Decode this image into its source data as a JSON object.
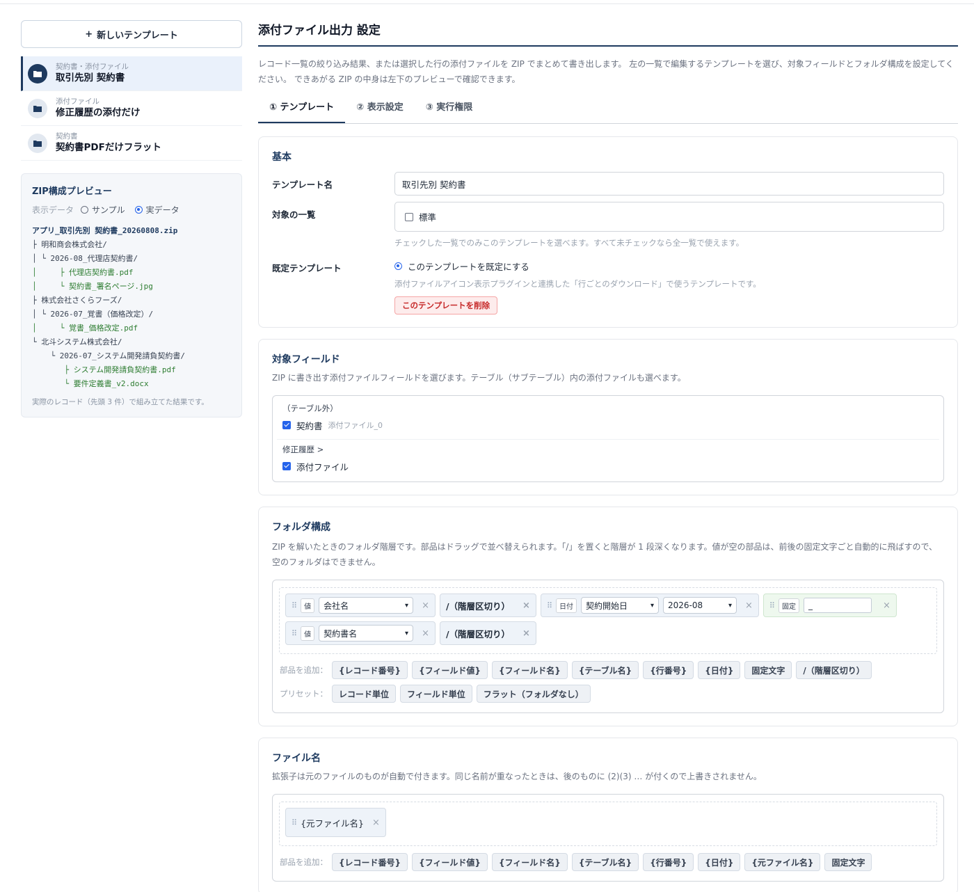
{
  "sidebar": {
    "new_template_label": "新しいテンプレート",
    "templates": [
      {
        "category": "契約書・添付ファイル",
        "name": "取引先別 契約書",
        "active": true
      },
      {
        "category": "添付ファイル",
        "name": "修正履歴の添付だけ",
        "active": false
      },
      {
        "category": "契約書",
        "name": "契約書PDFだけフラット",
        "active": false
      }
    ],
    "preview": {
      "title": "ZIP構成プレビュー",
      "mode_label": "表示データ",
      "mode_sample": "サンプル",
      "mode_real": "実データ",
      "selected_mode": "実データ",
      "zip_name": "アプリ_取引先別 契約書_20260808.zip",
      "tree": [
        {
          "prefix": "├ ",
          "text": "明和商会株式会社/",
          "kind": "dir"
        },
        {
          "prefix": "│ └ ",
          "text": "2026-08_代理店契約書/",
          "kind": "dir"
        },
        {
          "prefix": "│     ├ ",
          "text": "代理店契約書.pdf",
          "kind": "file"
        },
        {
          "prefix": "│     └ ",
          "text": "契約書_署名ページ.jpg",
          "kind": "file"
        },
        {
          "prefix": "├ ",
          "text": "株式会社さくらフーズ/",
          "kind": "dir"
        },
        {
          "prefix": "│ └ ",
          "text": "2026-07_覚書（価格改定）/",
          "kind": "dir"
        },
        {
          "prefix": "│     └ ",
          "text": "覚書_価格改定.pdf",
          "kind": "file"
        },
        {
          "prefix": "└ ",
          "text": "北斗システム株式会社/",
          "kind": "dir"
        },
        {
          "prefix": "    └ ",
          "text": "2026-07_システム開発請負契約書/",
          "kind": "dir"
        },
        {
          "prefix": "       ├ ",
          "text": "システム開発請負契約書.pdf",
          "kind": "file"
        },
        {
          "prefix": "       └ ",
          "text": "要件定義書_v2.docx",
          "kind": "file"
        }
      ],
      "note": "実際のレコード（先頭 3 件）で組み立てた結果です。"
    }
  },
  "main": {
    "title": "添付ファイル出力 設定",
    "description": "レコード一覧の絞り込み結果、または選択した行の添付ファイルを ZIP でまとめて書き出します。 左の一覧で編集するテンプレートを選び、対象フィールドとフォルダ構成を設定してください。 できあがる ZIP の中身は左下のプレビューで確認できます。",
    "tabs": [
      {
        "label": "① テンプレート",
        "active": true
      },
      {
        "label": "② 表示設定",
        "active": false
      },
      {
        "label": "③ 実行権限",
        "active": false
      }
    ],
    "basic": {
      "title": "基本",
      "name_label": "テンプレート名",
      "name_value": "取引先別 契約書",
      "views_label": "対象の一覧",
      "views_option": "標準",
      "views_checked": false,
      "views_hint": "チェックした一覧でのみこのテンプレートを選べます。すべて未チェックなら全一覧で使えます。",
      "default_label": "既定テンプレート",
      "default_option": "このテンプレートを既定にする",
      "default_hint": "添付ファイルアイコン表示プラグインと連携した「行ごとのダウンロード」で使うテンプレートです。",
      "delete_label": "このテンプレートを削除"
    },
    "fields": {
      "title": "対象フィールド",
      "description": "ZIP に書き出す添付ファイルフィールドを選びます。テーブル（サブテーブル）内の添付ファイルも選べます。",
      "group1_title": "（テーブル外）",
      "group1_item": "契約書",
      "group1_item_code": "添付ファイル_0",
      "group2_title": "修正履歴 >",
      "group2_item": "添付ファイル"
    },
    "folder": {
      "title": "フォルダ構成",
      "description": "ZIP を解いたときのフォルダ階層です。部品はドラッグで並べ替えられます。「/」を置くと階層が 1 段深くなります。値が空の部品は、前後の固定文字ごと自動的に飛ばすので、空のフォルダはできません。",
      "tag_value": "値",
      "tag_date": "日付",
      "tag_fixed": "固定",
      "part1_select": "会社名",
      "separator_label": "/（階層区切り）",
      "part3_field": "契約開始日",
      "part3_format": "2026-08",
      "part4_fixed_value": "_",
      "part6_select": "契約書名",
      "add_label": "部品を追加：",
      "add_buttons": [
        "{レコード番号}",
        "{フィールド値}",
        "{フィールド名}",
        "{テーブル名}",
        "{行番号}",
        "{日付}",
        "固定文字",
        "/（階層区切り）"
      ],
      "preset_label": "プリセット：",
      "preset_buttons": [
        "レコード単位",
        "フィールド単位",
        "フラット（フォルダなし）"
      ]
    },
    "filename": {
      "title": "ファイル名",
      "description": "拡張子は元のファイルのものが自動で付きます。同じ名前が重なったときは、後のものに (2)(3) … が付くので上書きされません。",
      "part1": "{元ファイル名}",
      "add_label": "部品を追加：",
      "add_buttons": [
        "{レコード番号}",
        "{フィールド値}",
        "{フィールド名}",
        "{テーブル名}",
        "{行番号}",
        "{日付}",
        "{元ファイル名}",
        "固定文字"
      ]
    }
  },
  "colors": {
    "accent": "#1e3a5f",
    "link": "#2563eb",
    "danger": "#c62828",
    "tree_file": "#2e7d32"
  }
}
